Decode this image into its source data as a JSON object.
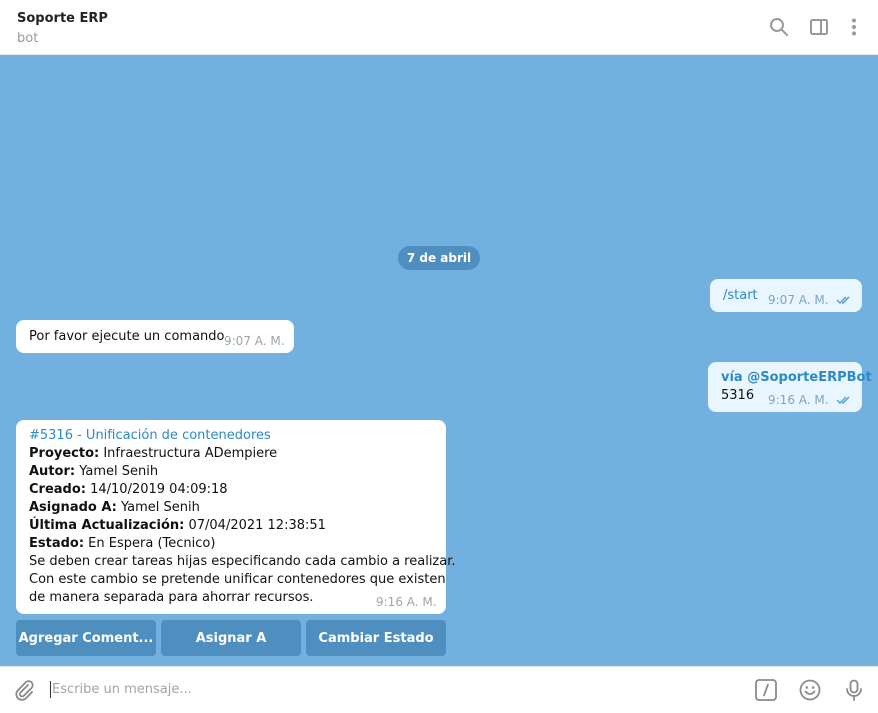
{
  "header": {
    "title": "Soporte ERP",
    "subtitle": "bot",
    "icons": [
      "search-icon",
      "sidebar-icon",
      "more-vertical-icon"
    ]
  },
  "chat": {
    "background": "#72b1df",
    "date_separator": "7 de abril",
    "messages": [
      {
        "type": "outgoing",
        "text": "/start",
        "time": "9:07 A. M.",
        "status": "read"
      },
      {
        "type": "incoming",
        "text": "Por favor ejecute un comando",
        "time": "9:07 A. M."
      },
      {
        "type": "outgoing",
        "via": "vía @SoporteERPBot",
        "text": "5316",
        "time": "9:16 A. M.",
        "status": "read"
      },
      {
        "type": "incoming",
        "link": "#5316 - Unificación de contenedores",
        "fields": [
          {
            "label": "Proyecto:",
            "value": " Infraestructura ADempiere"
          },
          {
            "label": "Autor:",
            "value": " Yamel Senih"
          },
          {
            "label": "Creado:",
            "value": " 14/10/2019 04:09:18"
          },
          {
            "label": "Asignado A:",
            "value": " Yamel Senih"
          },
          {
            "label": "Última Actualización:",
            "value": " 07/04/2021 12:38:51"
          },
          {
            "label": "Estado:",
            "value": " En Espera (Tecnico)"
          }
        ],
        "body_lines": [
          "Se deben crear tareas hijas especificando cada cambio a realizar.",
          "Con este cambio se pretende unificar contenedores que existen",
          "de manera separada para ahorrar recursos."
        ],
        "time": "9:16 A. M."
      }
    ],
    "inline_keyboard": [
      "Agregar Coment...",
      "Asignar A",
      "Cambiar Estado"
    ]
  },
  "composer": {
    "placeholder": "Escribe un mensaje...",
    "icons": [
      "attach-icon",
      "bot-command-icon",
      "emoji-icon",
      "microphone-icon"
    ]
  },
  "colors": {
    "accent": "#2c8ac7",
    "button": "#4f8fc0",
    "outgoing_bubble": "#e9f6ff"
  }
}
